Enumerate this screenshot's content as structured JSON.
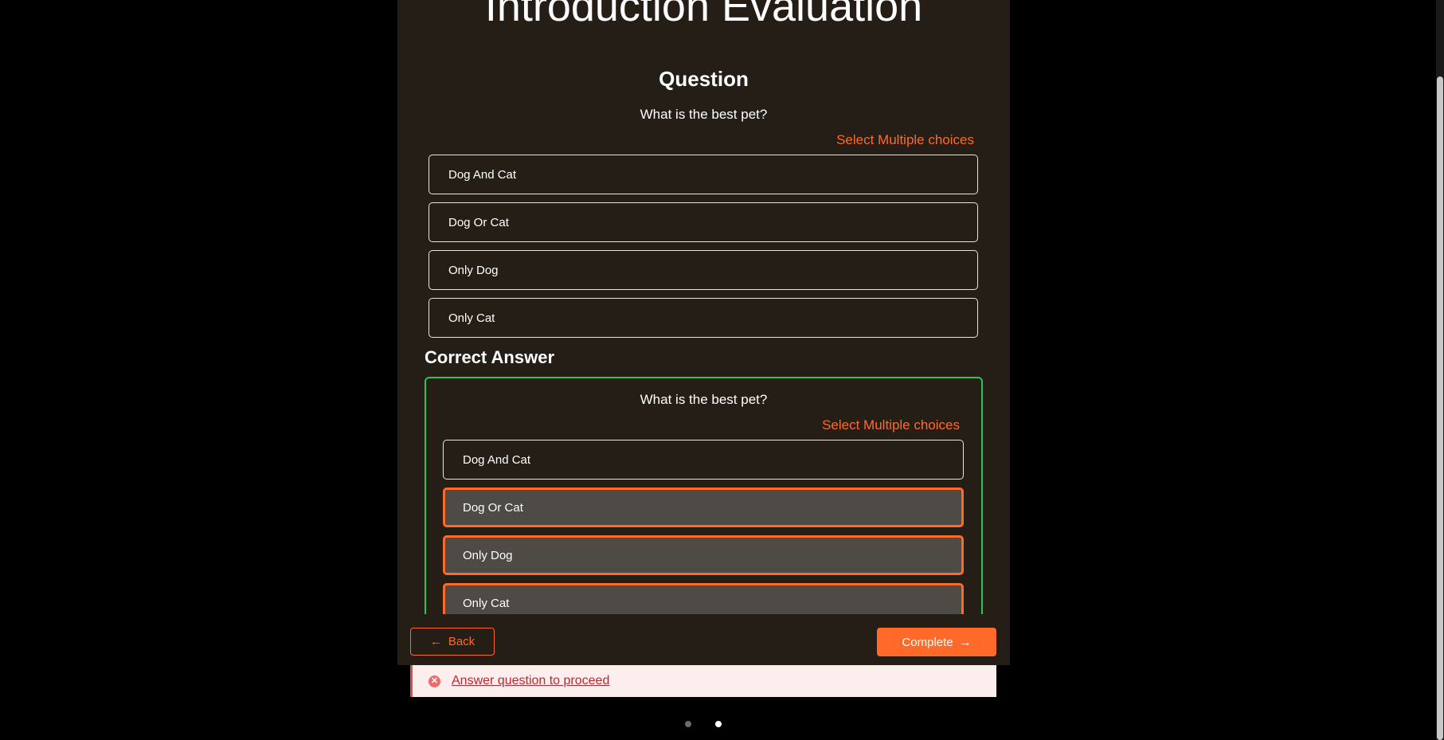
{
  "page": {
    "title": "Introduction Evaluation"
  },
  "question": {
    "heading": "Question",
    "text": "What is the best pet?",
    "hint": "Select Multiple choices",
    "options": [
      "Dog And Cat",
      "Dog Or Cat",
      "Only Dog",
      "Only Cat"
    ]
  },
  "correct_answer": {
    "heading": "Correct Answer",
    "text": "What is the best pet?",
    "hint": "Select Multiple choices",
    "options": [
      {
        "label": "Dog And Cat",
        "selected": false
      },
      {
        "label": "Dog Or Cat",
        "selected": true
      },
      {
        "label": "Only Dog",
        "selected": true
      },
      {
        "label": "Only Cat",
        "selected": true
      }
    ]
  },
  "footer": {
    "back_label": "Back",
    "back_arrow": "←",
    "complete_label": "Complete",
    "complete_arrow": "→"
  },
  "error": {
    "icon": "close-circle-icon",
    "message": "Answer question to proceed"
  },
  "pagination": {
    "total": 2,
    "active_index": 1
  },
  "colors": {
    "accent": "#ff6a2b",
    "correct_border": "#2ec25a",
    "panel_bg": "#241e17",
    "selected_bg": "#4e4a45",
    "error_text": "#c0262d"
  }
}
